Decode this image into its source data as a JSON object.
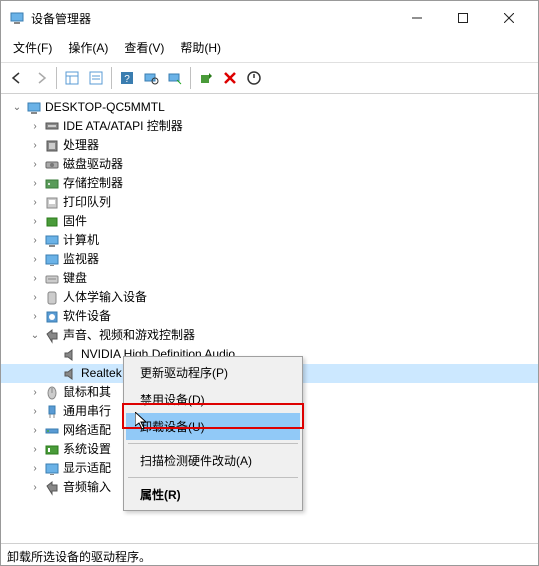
{
  "window": {
    "title": "设备管理器"
  },
  "menus": {
    "file": "文件(F)",
    "action": "操作(A)",
    "view": "查看(V)",
    "help": "帮助(H)"
  },
  "tree": {
    "root": "DESKTOP-QC5MMTL",
    "items": [
      {
        "label": "IDE ATA/ATAPI 控制器",
        "expand": ">"
      },
      {
        "label": "处理器",
        "expand": ">"
      },
      {
        "label": "磁盘驱动器",
        "expand": ">"
      },
      {
        "label": "存储控制器",
        "expand": ">"
      },
      {
        "label": "打印队列",
        "expand": ">"
      },
      {
        "label": "固件",
        "expand": ">"
      },
      {
        "label": "计算机",
        "expand": ">"
      },
      {
        "label": "监视器",
        "expand": ">"
      },
      {
        "label": "键盘",
        "expand": ">"
      },
      {
        "label": "人体学输入设备",
        "expand": ">"
      },
      {
        "label": "软件设备",
        "expand": ">"
      },
      {
        "label": "声音、视频和游戏控制器",
        "expand": "v",
        "children": [
          {
            "label": "NVIDIA High Definition Audio"
          },
          {
            "label": "Realtek High Definition Audio",
            "selected": true
          }
        ]
      },
      {
        "label": "鼠标和其",
        "expand": ">"
      },
      {
        "label": "通用串行",
        "expand": ">"
      },
      {
        "label": "网络适配",
        "expand": ">"
      },
      {
        "label": "系统设置",
        "expand": ">"
      },
      {
        "label": "显示适配",
        "expand": ">"
      },
      {
        "label": "音频输入",
        "expand": ">"
      }
    ]
  },
  "context_menu": {
    "update_driver": "更新驱动程序(P)",
    "disable": "禁用设备(D)",
    "uninstall": "卸载设备(U)",
    "scan": "扫描检测硬件改动(A)",
    "properties": "属性(R)"
  },
  "statusbar": "卸载所选设备的驱动程序。"
}
